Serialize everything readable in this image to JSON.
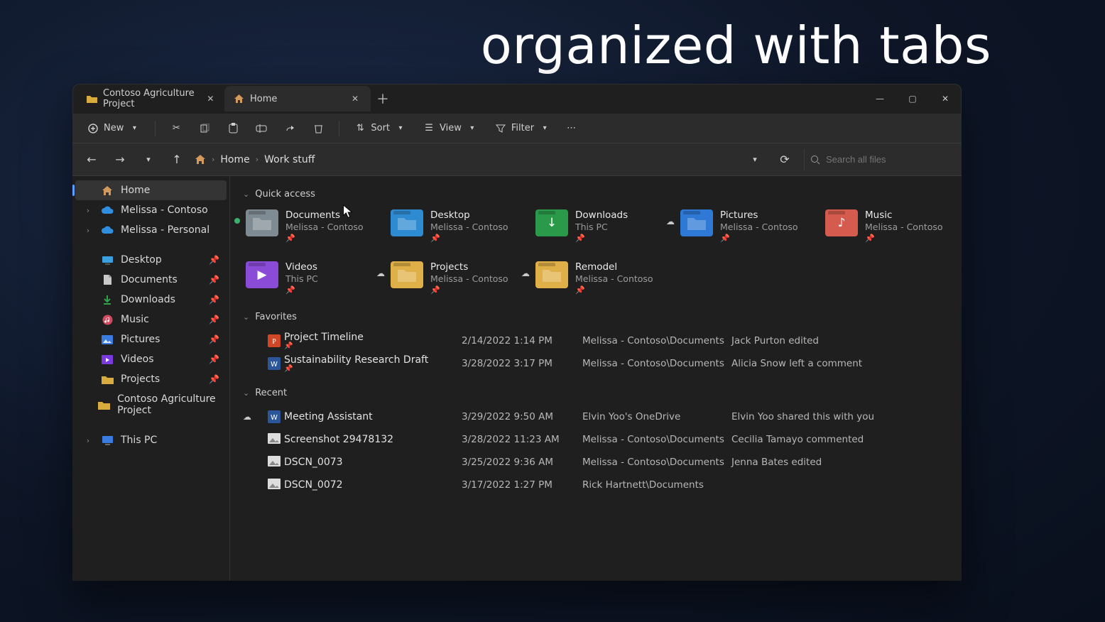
{
  "overlay_text": "organized with tabs",
  "tabs": [
    {
      "label": "Contoso Agriculture Project",
      "active": false
    },
    {
      "label": "Home",
      "active": true
    }
  ],
  "toolbar": {
    "new_label": "New",
    "sort_label": "Sort",
    "view_label": "View",
    "filter_label": "Filter"
  },
  "breadcrumb": {
    "part1": "Home",
    "part2": "Work stuff"
  },
  "search": {
    "placeholder": "Search all files"
  },
  "sidebar": {
    "home": "Home",
    "accounts": [
      {
        "label": "Melissa - Contoso"
      },
      {
        "label": "Melissa - Personal"
      }
    ],
    "pinned": [
      {
        "label": "Desktop",
        "icon": "desktop",
        "color": "#3aa0e2"
      },
      {
        "label": "Documents",
        "icon": "doc",
        "color": "#c9c9c9"
      },
      {
        "label": "Downloads",
        "icon": "download",
        "color": "#2fa24b"
      },
      {
        "label": "Music",
        "icon": "music",
        "color": "#d24a5d"
      },
      {
        "label": "Pictures",
        "icon": "pictures",
        "color": "#3a7be0"
      },
      {
        "label": "Videos",
        "icon": "videos",
        "color": "#7a3ae0"
      },
      {
        "label": "Projects",
        "icon": "folder",
        "color": "#d9aa3c"
      }
    ],
    "extra": [
      {
        "label": "Contoso Agriculture Project",
        "icon": "folder",
        "color": "#d9aa3c"
      }
    ],
    "this_pc": "This PC"
  },
  "sections": {
    "quick_access_label": "Quick access",
    "favorites_label": "Favorites",
    "recent_label": "Recent"
  },
  "quick_access": [
    {
      "title": "Documents",
      "sub": "Melissa - Contoso",
      "color": "#7f8b92",
      "status": "sync"
    },
    {
      "title": "Desktop",
      "sub": "Melissa - Contoso",
      "color": "#2f8bd1"
    },
    {
      "title": "Downloads",
      "sub": "This PC",
      "color": "#2a9a4a",
      "glyph": "↓"
    },
    {
      "title": "Pictures",
      "sub": "Melissa - Contoso",
      "color": "#2e78d6",
      "status": "cloud"
    },
    {
      "title": "Music",
      "sub": "Melissa - Contoso",
      "color": "#d55b4e",
      "glyph": "♪"
    },
    {
      "title": "Videos",
      "sub": "This PC",
      "color": "#8a4bd6",
      "glyph": "▶"
    },
    {
      "title": "Projects",
      "sub": "Melissa - Contoso",
      "color": "#e0b048",
      "status": "cloud"
    },
    {
      "title": "Remodel",
      "sub": "Melissa - Contoso",
      "color": "#e0b048",
      "status": "cloud"
    }
  ],
  "favorites": [
    {
      "name": "Project Timeline",
      "date": "2/14/2022 1:14 PM",
      "loc": "Melissa - Contoso\\Documents",
      "act": "Jack Purton edited",
      "icon": "ppt",
      "dot": "green"
    },
    {
      "name": "Sustainability Research Draft",
      "date": "3/28/2022 3:17 PM",
      "loc": "Melissa - Contoso\\Documents",
      "act": "Alicia Snow left a comment",
      "icon": "word",
      "dot": "green"
    }
  ],
  "recent": [
    {
      "name": "Meeting Assistant",
      "date": "3/29/2022 9:50 AM",
      "loc": "Elvin Yoo's OneDrive",
      "act": "Elvin Yoo shared this with you",
      "icon": "word",
      "dot": "cloud"
    },
    {
      "name": "Screenshot 29478132",
      "date": "3/28/2022 11:23 AM",
      "loc": "Melissa - Contoso\\Documents",
      "act": "Cecilia Tamayo commented",
      "icon": "image",
      "dot": "grey"
    },
    {
      "name": "DSCN_0073",
      "date": "3/25/2022 9:36 AM",
      "loc": "Melissa - Contoso\\Documents",
      "act": "Jenna Bates edited",
      "icon": "image",
      "dot": "grey"
    },
    {
      "name": "DSCN_0072",
      "date": "3/17/2022 1:27 PM",
      "loc": "Rick Hartnett\\Documents",
      "act": "",
      "icon": "image",
      "dot": "grey"
    }
  ]
}
